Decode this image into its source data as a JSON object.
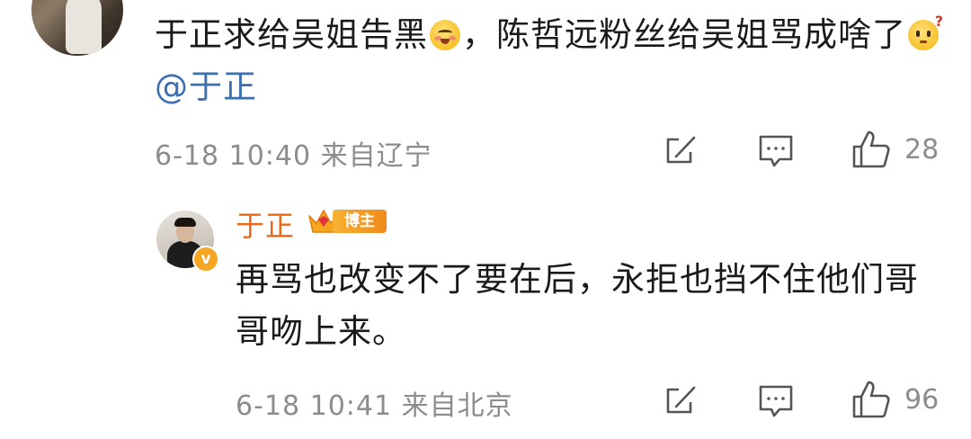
{
  "comment": {
    "text_part1": "于正求给吴姐告黑",
    "emoji1": "blush-smile-emoji",
    "text_part2": "，陈哲远粉丝给吴姐骂成啥了",
    "emoji2": "thinking-question-emoji",
    "mention": "@于正",
    "meta": "6-18 10:40 来自辽宁",
    "like_count": "28"
  },
  "reply": {
    "author": "于正",
    "badge_label": "博主",
    "verified_mark": "v",
    "text": "再骂也改变不了要在后，永拒也挡不住他们哥哥吻上来。",
    "meta": "6-18 10:41 来自北京",
    "like_count": "96"
  },
  "icons": {
    "share": "share-icon",
    "comment": "comment-icon",
    "like": "thumbs-up-icon"
  },
  "colors": {
    "mention": "#3b6fb0",
    "author_name": "#e86a18",
    "meta_gray": "#8c8c8c",
    "badge_orange": "#f5a623"
  }
}
